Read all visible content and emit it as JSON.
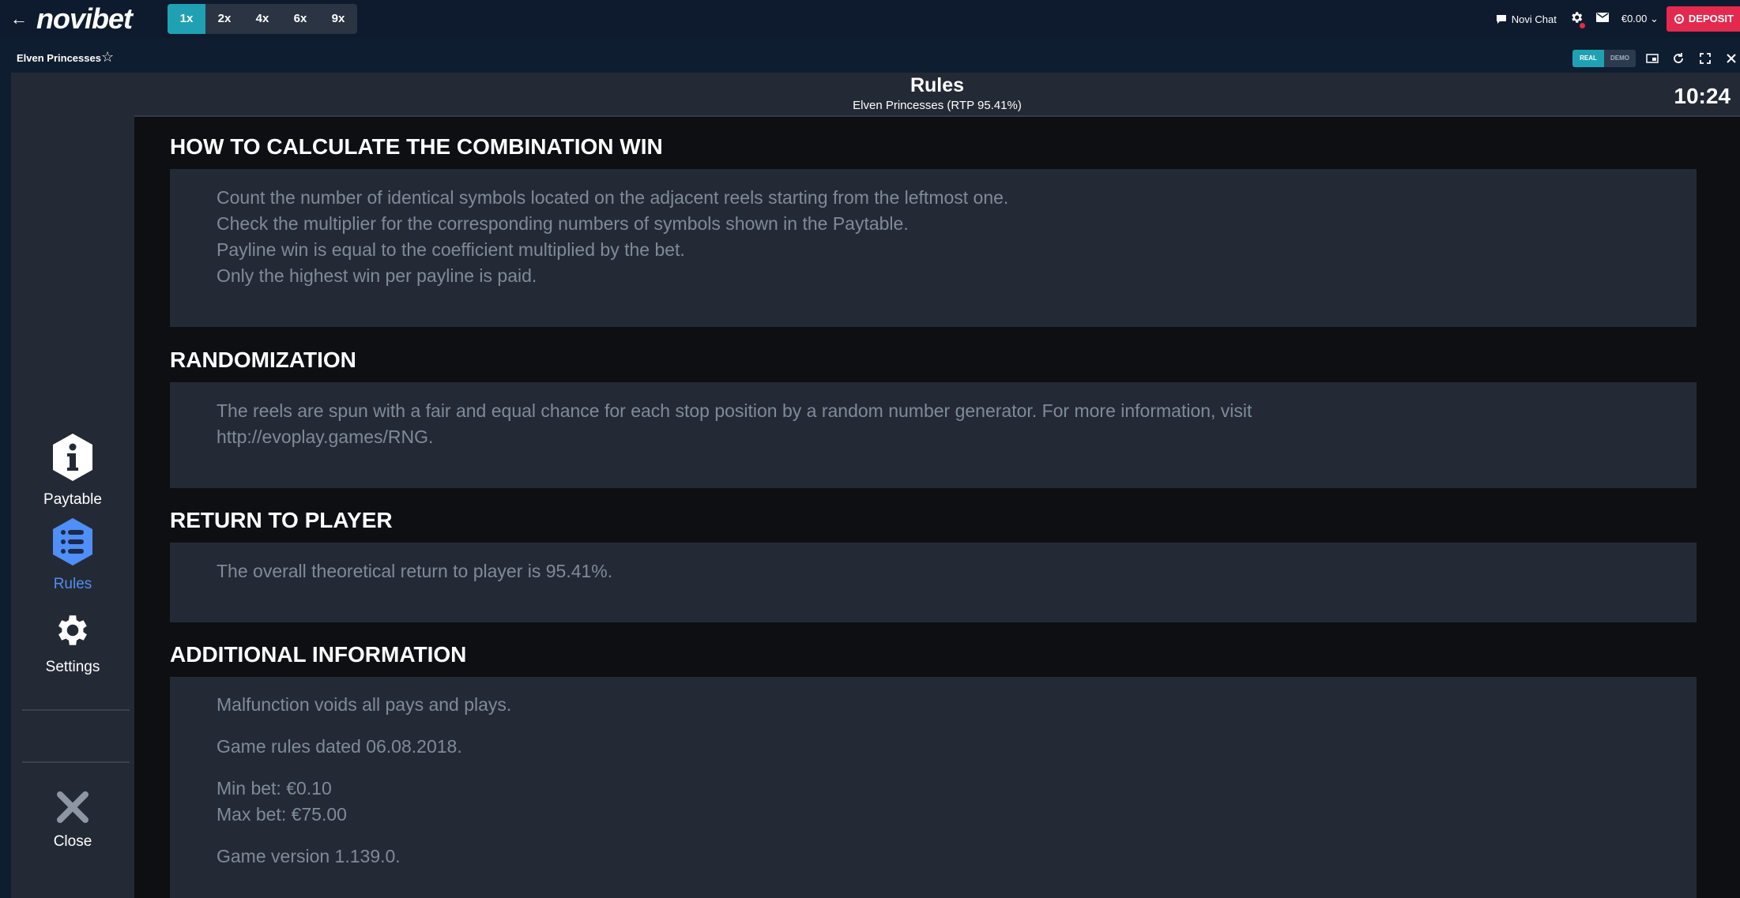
{
  "topbar": {
    "logo": "novibet",
    "speeds": [
      "1x",
      "2x",
      "4x",
      "6x",
      "9x"
    ],
    "chat_label": "Novi Chat",
    "balance": "€0.00",
    "deposit_label": "DEPOSIT"
  },
  "subbar": {
    "game_title": "Elven Princesses",
    "mode_real": "REAL",
    "mode_demo": "DEMO"
  },
  "sidebar": {
    "paytable": "Paytable",
    "rules": "Rules",
    "settings": "Settings",
    "close": "Close"
  },
  "header": {
    "title": "Rules",
    "subtitle": "Elven Princesses (RTP 95.41%)",
    "clock": "10:24"
  },
  "sections": {
    "combination": {
      "title": "HOW TO CALCULATE THE COMBINATION WIN",
      "lines": [
        "Count the number of identical symbols located on the adjacent reels starting from the leftmost one.",
        "Check the multiplier for the corresponding numbers of symbols shown in the Paytable.",
        "Payline win is equal to the coefficient multiplied by the bet.",
        "Only the highest win per payline is paid."
      ]
    },
    "randomization": {
      "title": "RANDOMIZATION",
      "lines": [
        "The reels are spun with a fair and equal chance for each stop position by a random number generator. For more information, visit",
        "http://evoplay.games/RNG."
      ]
    },
    "rtp": {
      "title": "RETURN TO PLAYER",
      "lines": [
        "The overall theoretical return to player is 95.41%."
      ]
    },
    "additional": {
      "title": "ADDITIONAL INFORMATION",
      "lines": [
        "Malfunction voids all pays and plays.",
        "Game rules dated 06.08.2018.",
        "Min bet: €0.10",
        "Max bet: €75.00",
        "Game version 1.139.0."
      ]
    }
  },
  "colors": {
    "accent_teal": "#1fa1b3",
    "deposit_red": "#e32a4e",
    "active_blue": "#4f8ff7",
    "panel": "#242a35",
    "body_text": "#7f8a9a"
  }
}
